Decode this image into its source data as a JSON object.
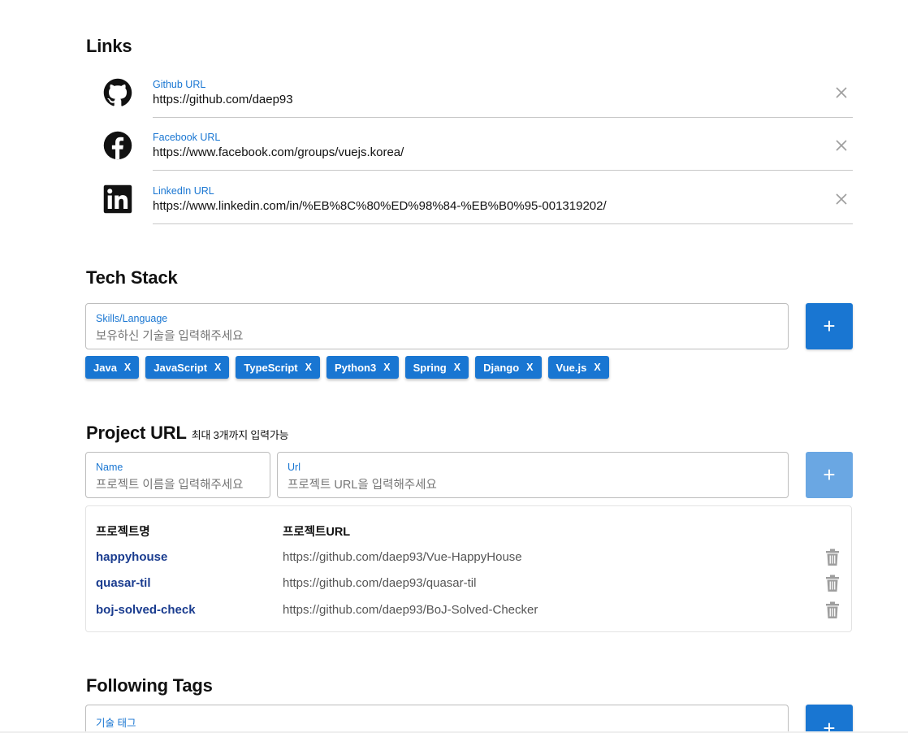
{
  "links": {
    "title": "Links",
    "items": [
      {
        "label": "Github URL",
        "value": "https://github.com/daep93",
        "icon": "github-icon"
      },
      {
        "label": "Facebook URL",
        "value": "https://www.facebook.com/groups/vuejs.korea/",
        "icon": "facebook-icon"
      },
      {
        "label": "LinkedIn URL",
        "value": "https://www.linkedin.com/in/%EB%8C%80%ED%98%84-%EB%B0%95-001319202/",
        "icon": "linkedin-icon"
      }
    ],
    "clear_glyph": "✕"
  },
  "tech_stack": {
    "title": "Tech Stack",
    "input_label": "Skills/Language",
    "input_placeholder": "보유하신 기술을 입력해주세요",
    "add_label": "+",
    "chips": [
      "Java",
      "JavaScript",
      "TypeScript",
      "Python3",
      "Spring",
      "Django",
      "Vue.js"
    ],
    "chip_remove": "X"
  },
  "project_url": {
    "title": "Project URL",
    "subtitle": "최대 3개까지 입력가능",
    "name_label": "Name",
    "name_placeholder": "프로젝트 이름을 입력해주세요",
    "url_label": "Url",
    "url_placeholder": "프로젝트 URL을 입력해주세요",
    "add_label": "+",
    "columns": [
      "프로젝트명",
      "프로젝트URL"
    ],
    "rows": [
      {
        "name": "happyhouse",
        "url": "https://github.com/daep93/Vue-HappyHouse"
      },
      {
        "name": "quasar-til",
        "url": "https://github.com/daep93/quasar-til"
      },
      {
        "name": "boj-solved-check",
        "url": "https://github.com/daep93/BoJ-Solved-Checker"
      }
    ]
  },
  "following_tags": {
    "title": "Following Tags",
    "input_label": "기술 태그",
    "add_label": "+"
  },
  "colors": {
    "accent": "#1976d2",
    "accent_disabled": "#6aa7e3",
    "link_name": "#1a3c8f"
  }
}
